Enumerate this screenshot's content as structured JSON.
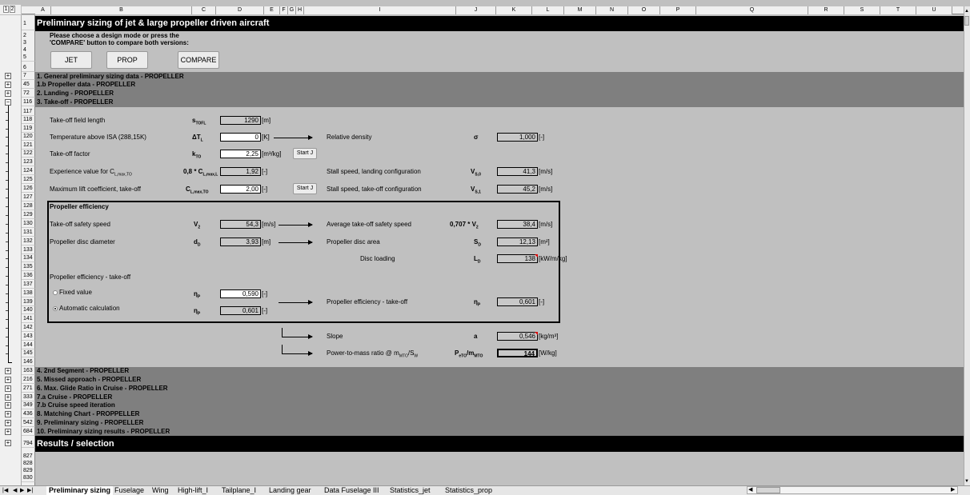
{
  "outline": {
    "levels": [
      "1",
      "2"
    ]
  },
  "columns": [
    "A",
    "B",
    "C",
    "D",
    "E",
    "F",
    "G",
    "H",
    "I",
    "J",
    "K",
    "L",
    "M",
    "N",
    "O",
    "P",
    "Q",
    "R",
    "S",
    "T",
    "U"
  ],
  "header": {
    "title": "Preliminary sizing of jet & large propeller driven aircraft"
  },
  "intro": {
    "line1": "Please choose a design mode or press the",
    "line2": "'COMPARE' button to compare both versions:"
  },
  "buttons": {
    "jet": "JET",
    "prop": "PROP",
    "compare": "COMPARE",
    "start_j": "Start J"
  },
  "rows": {
    "r1": "1",
    "r2": "2",
    "r3": "3",
    "r4": "4",
    "r5": "5",
    "r6": "6",
    "r7": "7",
    "r45": "45",
    "r72": "72",
    "r116": "116",
    "r117": "117",
    "r118": "118",
    "r119": "119",
    "r120": "120",
    "r121": "121",
    "r122": "122",
    "r123": "123",
    "r124": "124",
    "r125": "125",
    "r126": "126",
    "r127": "127",
    "r128": "128",
    "r129": "129",
    "r130": "130",
    "r131": "131",
    "r132": "132",
    "r133": "133",
    "r134": "134",
    "r135": "135",
    "r136": "136",
    "r137": "137",
    "r138": "138",
    "r139": "139",
    "r140": "140",
    "r141": "141",
    "r142": "142",
    "r143": "143",
    "r144": "144",
    "r145": "145",
    "r146": "146",
    "r163": "163",
    "r216": "216",
    "r271": "271",
    "r333": "333",
    "r349": "349",
    "r436": "436",
    "r542": "542",
    "r684": "684",
    "r794": "794",
    "r827": "827",
    "r828": "828",
    "r829": "829",
    "r830": "830"
  },
  "sections_top": [
    {
      "label": "1.   General preliminary sizing data - PROPELLER"
    },
    {
      "label": "1.b  Propeller data - PROPELLER"
    },
    {
      "label": "2.   Landing - PROPELLER"
    },
    {
      "label": "3.   Take-off - PROPELLER"
    }
  ],
  "takeoff": {
    "field_length": {
      "label": "Take-off field length",
      "symbol": "s",
      "sub": "TOFL",
      "value": "1290",
      "unit": "[m]"
    },
    "temperature": {
      "label": "Temperature above ISA (288,15K)",
      "symbol": "ΔT",
      "sub": "L",
      "value": "0",
      "unit": "[K]"
    },
    "factor": {
      "label": "Take-off factor",
      "symbol": "k",
      "sub": "TO",
      "value": "2,25",
      "unit": "[m³/kg]"
    },
    "experience": {
      "label": "Experience value for C",
      "label_sub": "L,max,TO",
      "symbol": "0,8 * C",
      "sub": "L,max,L",
      "value": "1,92",
      "unit": "[-]"
    },
    "max_lift": {
      "label": "Maximum lift coefficient, take-off",
      "symbol": "C",
      "sub": "L,max,TO",
      "value": "2,00",
      "unit": "[-]"
    },
    "rel_density": {
      "label": "Relative density",
      "symbol": "σ",
      "value": "1,000",
      "unit": "[-]"
    },
    "stall_landing": {
      "label": "Stall speed, landing configuration",
      "symbol": "V",
      "sub": "S,0",
      "value": "41,3",
      "unit": "[m/s]"
    },
    "stall_takeoff": {
      "label": "Stall speed, take-off configuration",
      "symbol": "V",
      "sub": "S,1",
      "value": "45,2",
      "unit": "[m/s]"
    }
  },
  "propeller": {
    "title": "Propeller efficiency",
    "safety_speed": {
      "label": "Take-off safety speed",
      "symbol": "V",
      "sub": "2",
      "value": "54,3",
      "unit": "[m/s]"
    },
    "avg_safety_speed": {
      "label": "Average take-off safety speed",
      "symbol": "0,707 * V",
      "sub": "2",
      "value": "38,4",
      "unit": "[m/s]"
    },
    "disc_diameter": {
      "label": "Propeller disc diameter",
      "symbol": "d",
      "sub": "D",
      "value": "3,93",
      "unit": "[m]"
    },
    "disc_area": {
      "label": "Propeller disc area",
      "symbol": "S",
      "sub": "D",
      "value": "12,13",
      "unit": "[m²]"
    },
    "disc_loading": {
      "label": "Disc loading",
      "symbol": "L",
      "sub": "D",
      "value": "138",
      "unit": "[kW/m/kg]"
    },
    "eff_title": "Propeller efficiency - take-off",
    "fixed": {
      "label": "Fixed value",
      "symbol": "η",
      "sub": "P",
      "value": "0,590",
      "unit": "[-]"
    },
    "auto": {
      "label": "Automatic calculation",
      "symbol": "η",
      "sub": "P",
      "value": "0,601",
      "unit": "[-]"
    },
    "eff_result": {
      "label": "Propeller efficiency - take-off",
      "symbol": "η",
      "sub": "P",
      "value": "0,601",
      "unit": "[-]"
    }
  },
  "results": {
    "slope": {
      "label": "Slope",
      "symbol": "a",
      "value": "0,546",
      "unit": "[kg/m³]"
    },
    "power": {
      "label": "Power-to-mass ratio @ m",
      "label_sub": "MTO",
      "label_tail": "/S",
      "label_sub2": "W",
      "symbol": "P",
      "sub": "eTO",
      "symbol2": "/m",
      "sub2": "MTO",
      "value": "144",
      "unit": "[W/kg]"
    }
  },
  "sections_bottom": [
    {
      "label": "4.   2nd Segment - PROPELLER"
    },
    {
      "label": "5.   Missed approach - PROPELLER"
    },
    {
      "label": "6.   Max. Glide Ratio in Cruise - PROPELLER"
    },
    {
      "label": "7.a  Cruise - PROPELLER"
    },
    {
      "label": "7.b  Cruise speed iteration"
    },
    {
      "label": "8.   Matching Chart - PROPPELLER"
    },
    {
      "label": "9.   Preliminary sizing - PROPELLER"
    },
    {
      "label": "10.  Preliminary sizing results - PROPELLER"
    }
  ],
  "results_header": {
    "title": "Results / selection"
  },
  "tabs": [
    "Preliminary sizing",
    "Fuselage",
    "Wing",
    "High-lift_I",
    "Tailplane_I",
    "Landing gear",
    "Data Fuselage III",
    "Statistics_jet",
    "Statistics_prop"
  ],
  "colors": {
    "grey_band": "#7f7f7f",
    "black_band": "#000000",
    "sheet_bg": "#c0c0c0",
    "input_bg": "#ffffff",
    "calc_bg": "#c8c8c8"
  }
}
